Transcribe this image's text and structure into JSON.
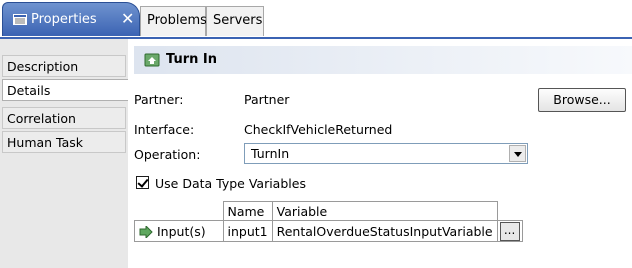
{
  "tabs": {
    "properties": "Properties",
    "problems": "Problems",
    "servers": "Servers"
  },
  "sidebar": {
    "items": [
      {
        "label": "Description"
      },
      {
        "label": "Details"
      },
      {
        "label": "Correlation"
      },
      {
        "label": "Human Task"
      }
    ]
  },
  "header": {
    "title": "Turn In"
  },
  "form": {
    "partner_label": "Partner:",
    "partner_value": "Partner",
    "browse_label": "Browse...",
    "interface_label": "Interface:",
    "interface_value": "CheckIfVehicleReturned",
    "operation_label": "Operation:",
    "operation_value": "TurnIn",
    "use_data_types_label": "Use Data Type Variables"
  },
  "table": {
    "col_name": "Name",
    "col_variable": "Variable",
    "row_label": "Input(s)",
    "row_name": "input1",
    "row_variable": "RentalOverdueStatusInputVariable",
    "ellipsis": "..."
  }
}
